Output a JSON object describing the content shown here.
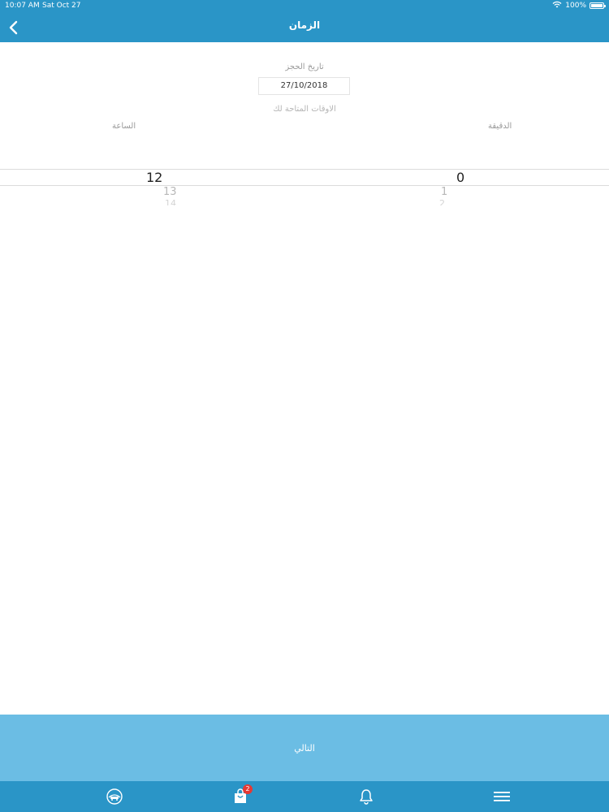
{
  "status_bar": {
    "time": "10:07 AM",
    "date": "Sat Oct 27",
    "battery": "100%",
    "battery_level": 1.0
  },
  "header": {
    "title": "الزمان"
  },
  "booking": {
    "date_label": "تاريخ الحجز",
    "date_value": "27/10/2018",
    "available_label": "الاوقات المتاحة لك"
  },
  "picker": {
    "hour_label": "الساعة",
    "minute_label": "الدقيقة",
    "hour_values": [
      "12",
      "13",
      "14"
    ],
    "minute_values": [
      "0",
      "1",
      "2"
    ]
  },
  "next_button": {
    "label": "التالي"
  },
  "tabbar": {
    "cart_badge": "2"
  },
  "colors": {
    "primary": "#2A95C7",
    "next_button": "#6BBDE4",
    "badge": "#E53935"
  },
  "icons": {
    "back": "chevron-left-icon",
    "home": "logo-icon",
    "cart": "bag-icon",
    "bell": "bell-icon",
    "menu": "menu-icon"
  }
}
